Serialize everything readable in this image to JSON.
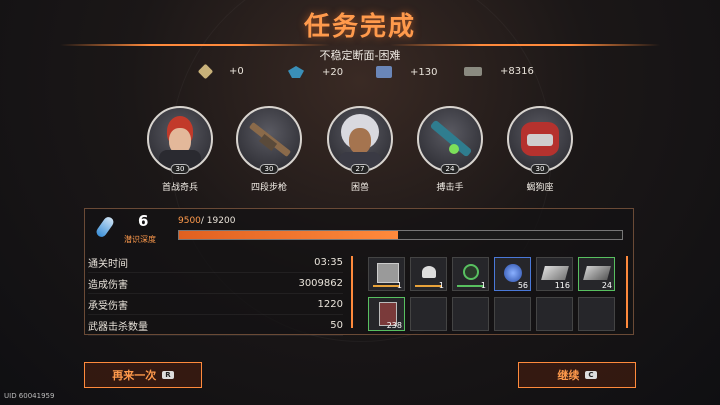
{
  "header": {
    "title": "任务完成",
    "subtitle": "不稳定断面-困难"
  },
  "rewards": [
    {
      "icon": "gold-crate-icon",
      "amount": "+0",
      "color": "#c9b27a"
    },
    {
      "icon": "blue-crystal-icon",
      "amount": "+20",
      "color": "#3a8fb8"
    },
    {
      "icon": "book-icon",
      "amount": "+130",
      "color": "#6a86b8"
    },
    {
      "icon": "cash-icon",
      "amount": "+8316",
      "color": "#8a8a80"
    }
  ],
  "characters": [
    {
      "name": "首战奇兵",
      "level": "30"
    },
    {
      "name": "四段步枪",
      "level": "30"
    },
    {
      "name": "困兽",
      "level": "27"
    },
    {
      "name": "搏击手",
      "level": "24"
    },
    {
      "name": "蝎狗座",
      "level": "30"
    }
  ],
  "depth": {
    "value": "6",
    "label": "潜识深度",
    "progress_current": "9500",
    "progress_max": "/ 19200",
    "progress_fraction": 0.495
  },
  "stats": [
    {
      "label": "通关时间",
      "value": "03:35"
    },
    {
      "label": "造成伤害",
      "value": "3009862"
    },
    {
      "label": "承受伤害",
      "value": "1220"
    },
    {
      "label": "武器击杀数量",
      "value": "50"
    }
  ],
  "items": [
    {
      "name": "supply-box-icon",
      "count": "1",
      "accent": "#e8a23a"
    },
    {
      "name": "ship-token-icon",
      "count": "1",
      "accent": "#e8a23a"
    },
    {
      "name": "green-gear-icon",
      "count": "1",
      "accent": "#58c060"
    },
    {
      "name": "blue-orb-icon",
      "count": "56",
      "accent": "#4a78d8"
    },
    {
      "name": "metal-plate-icon",
      "count": "116",
      "accent": "#888888"
    },
    {
      "name": "green-plate-icon",
      "count": "24",
      "accent": "#58c060"
    },
    {
      "name": "material-card-icon",
      "count": "238",
      "accent": "#58c060"
    }
  ],
  "buttons": {
    "retry": "再来一次",
    "retry_key": "R",
    "continue": "继续",
    "continue_key": "C"
  },
  "footer": {
    "uid": "UID 60041959"
  }
}
